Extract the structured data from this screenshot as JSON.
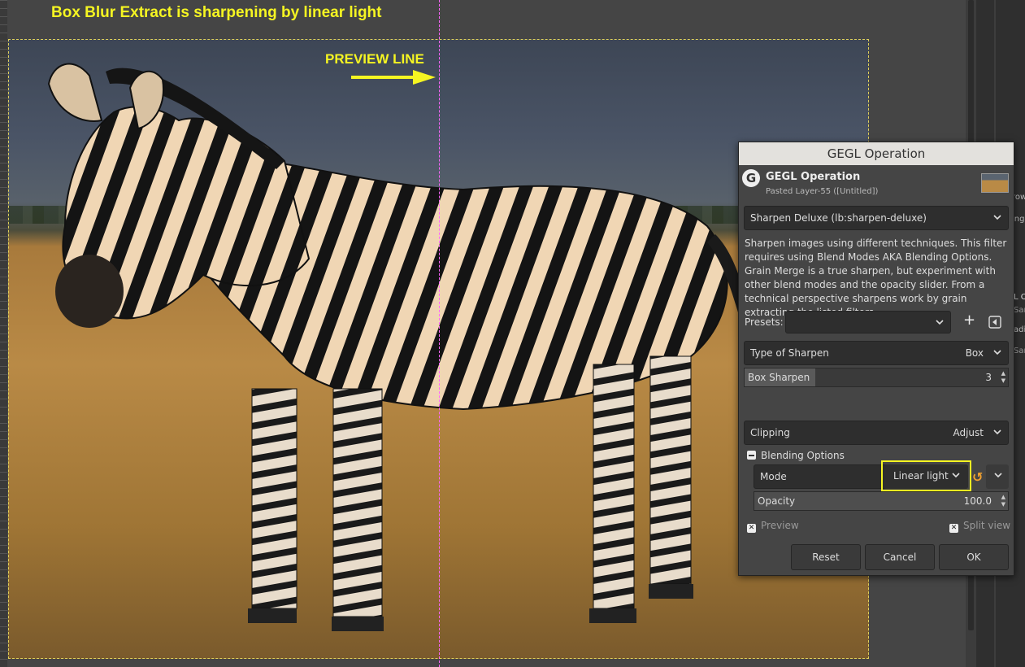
{
  "caption": "Box Blur Extract is sharpening by linear light",
  "preview_label": "PREVIEW LINE",
  "colors": {
    "annotation": "#f5f522",
    "preview_line": "#ff66ff",
    "selection_border": "#e0d05a"
  },
  "dialog": {
    "window_title": "GEGL Operation",
    "header_title": "GEGL Operation",
    "header_subtitle": "Pasted Layer-55 ([Untitled])",
    "filter_select": "Sharpen Deluxe (lb:sharpen-deluxe)",
    "description": "Sharpen images using different techniques. This filter requires using Blend Modes AKA Blending Options. Grain Merge is a true sharpen, but experiment with other blend modes and the opacity slider. From a technical perspective sharpens work by grain extracting the listed filters.",
    "presets_label": "Presets:",
    "presets_value": "",
    "type_of_sharpen": {
      "label": "Type of Sharpen",
      "value": "Box"
    },
    "box_sharpen": {
      "label": "Box Sharpen",
      "value": "3",
      "fill_fraction": 0.27
    },
    "clipping": {
      "label": "Clipping",
      "value": "Adjust"
    },
    "blending_options_label": "Blending Options",
    "mode": {
      "label": "Mode",
      "value": "Linear light"
    },
    "opacity": {
      "label": "Opacity",
      "value": "100.0",
      "fill_fraction": 1.0
    },
    "preview_label": "Preview",
    "split_view_label": "Split view",
    "buttons": {
      "reset": "Reset",
      "cancel": "Cancel",
      "ok": "OK"
    }
  },
  "right_panel": [
    "row",
    "ing",
    "L O",
    "Sar",
    "adi",
    "Sar"
  ]
}
